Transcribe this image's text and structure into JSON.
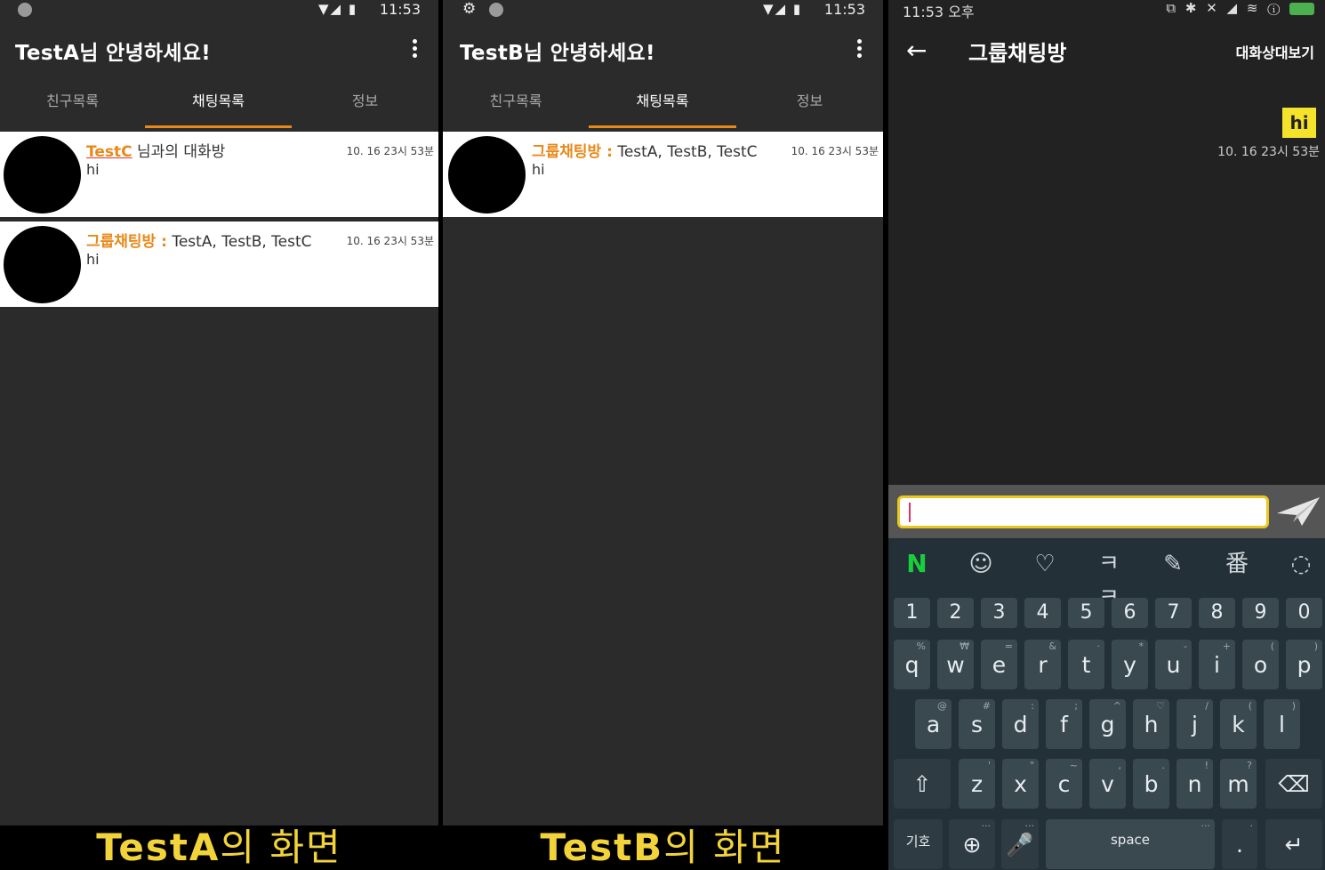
{
  "phone_a": {
    "status_time": "11:53",
    "title": "TestA님 안녕하세요!",
    "tabs": [
      "친구목록",
      "채팅목록",
      "정보"
    ],
    "chats": [
      {
        "name": "TestC",
        "name_suffix": " 님과의 대화방",
        "message": "hi",
        "time": "10. 16 23시 53분"
      },
      {
        "name": "그룹채팅방 :",
        "name_suffix": " TestA, TestB, TestC",
        "message": "hi",
        "time": "10. 16 23시 53분"
      }
    ],
    "caption_main": "TestA",
    "caption_suffix": "의 화면"
  },
  "phone_b": {
    "status_time": "11:53",
    "title": "TestB님 안녕하세요!",
    "tabs": [
      "친구목록",
      "채팅목록",
      "정보"
    ],
    "chats": [
      {
        "name": "그룹채팅방 :",
        "name_suffix": " TestA, TestB, TestC",
        "message": "hi",
        "time": "10. 16 23시 53분"
      }
    ],
    "caption_main": "TestB",
    "caption_suffix": "의 화면"
  },
  "phone_c": {
    "status_time": "11:53 오후",
    "title": "그룹채팅방",
    "action": "대화상대보기",
    "message": {
      "text": "hi",
      "time": "10. 16 23시 53분"
    },
    "input_value": "",
    "keyboard": {
      "tools": [
        "N",
        "☺",
        "♡",
        "ㅋㅋ",
        "✎",
        "番",
        "◌"
      ],
      "numbers": [
        "1",
        "2",
        "3",
        "4",
        "5",
        "6",
        "7",
        "8",
        "9",
        "0"
      ],
      "row1": [
        [
          "q",
          "%"
        ],
        [
          "w",
          "₩"
        ],
        [
          "e",
          "="
        ],
        [
          "r",
          "&"
        ],
        [
          "t",
          "·"
        ],
        [
          "y",
          "*"
        ],
        [
          "u",
          "-"
        ],
        [
          "i",
          "+"
        ],
        [
          "o",
          "("
        ],
        [
          "p",
          ")"
        ]
      ],
      "row2": [
        [
          "a",
          "@"
        ],
        [
          "s",
          "#"
        ],
        [
          "d",
          ":"
        ],
        [
          "f",
          ";"
        ],
        [
          "g",
          "^"
        ],
        [
          "h",
          "♡"
        ],
        [
          "j",
          "/"
        ],
        [
          "k",
          "("
        ],
        [
          "l",
          ")"
        ]
      ],
      "row3": [
        [
          "z",
          "'"
        ],
        [
          "x",
          "\""
        ],
        [
          "c",
          "~"
        ],
        [
          "v",
          ","
        ],
        [
          "b",
          "."
        ],
        [
          "n",
          "!"
        ],
        [
          "m",
          "?"
        ]
      ],
      "symbols_label": "기호",
      "space_label": "space",
      "period_label": "."
    }
  },
  "colors": {
    "accent": "#e8891a",
    "caption": "#f2d33a",
    "bubble": "#f5e22a",
    "naver": "#19ce3c"
  }
}
